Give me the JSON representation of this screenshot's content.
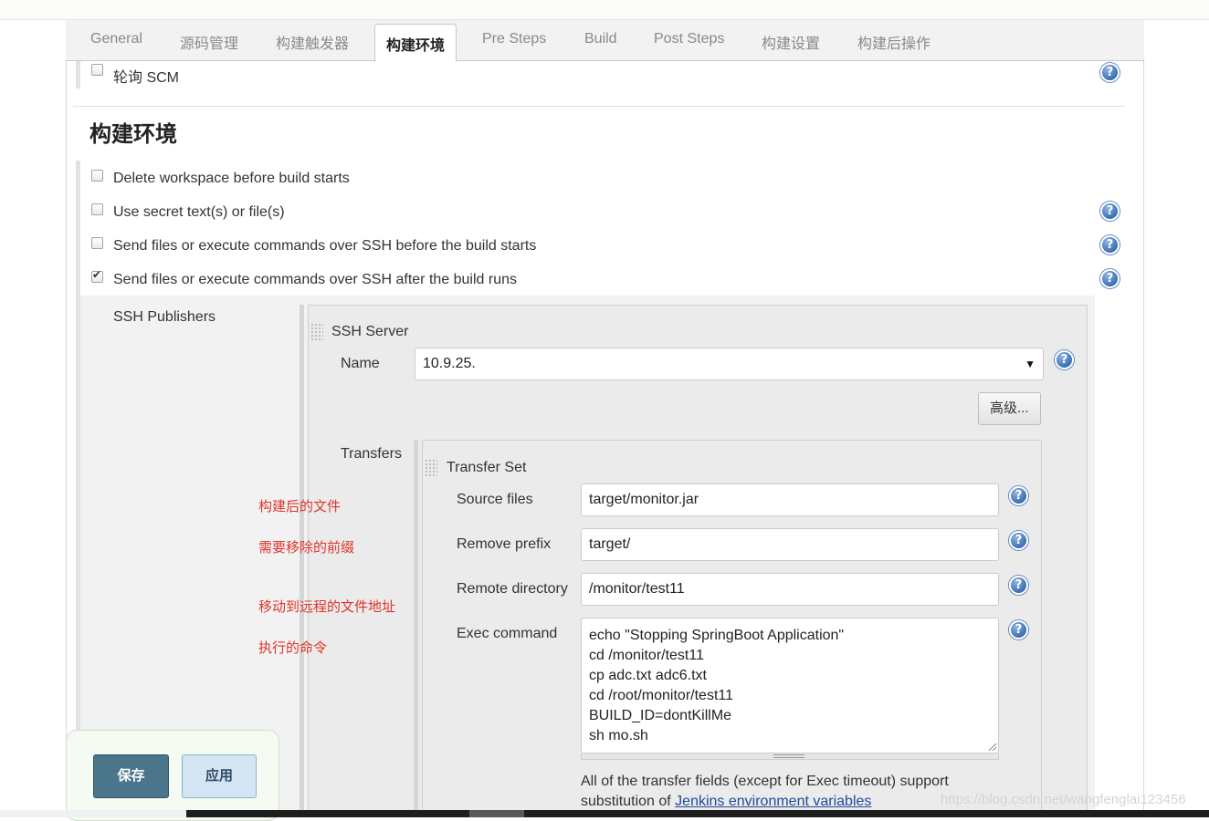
{
  "tabs": [
    "General",
    "源码管理",
    "构建触发器",
    "构建环境",
    "Pre Steps",
    "Build",
    "Post Steps",
    "构建设置",
    "构建后操作"
  ],
  "trigger": {
    "poll_scm": "轮询 SCM"
  },
  "section": {
    "title": "构建环境"
  },
  "options": {
    "delete_workspace": "Delete workspace before build starts",
    "secret_text": "Use secret text(s) or file(s)",
    "ssh_before": "Send files or execute commands over SSH before the build starts",
    "ssh_after": "Send files or execute commands over SSH after the build runs"
  },
  "ssh": {
    "publishers_label": "SSH Publishers",
    "server_title": "SSH Server",
    "name_label": "Name",
    "name_value": "10.9.25.",
    "advanced_button": "高级...",
    "transfers_label": "Transfers",
    "transfer_set_title": "Transfer Set",
    "source_files_label": "Source files",
    "source_files_value": "target/monitor.jar",
    "remove_prefix_label": "Remove prefix",
    "remove_prefix_value": "target/",
    "remote_directory_label": "Remote directory",
    "remote_directory_value": "/monitor/test11",
    "exec_command_label": "Exec command",
    "exec_command_value": "echo \"Stopping SpringBoot Application\"\ncd /monitor/test11\ncp adc.txt adc6.txt\ncd /root/monitor/test11\nBUILD_ID=dontKillMe\nsh mo.sh",
    "note_text": "All of the transfer fields (except for Exec timeout) support substitution of ",
    "note_link": "Jenkins environment variables"
  },
  "annotations": {
    "source": "构建后的文件",
    "prefix": "需要移除的前缀",
    "remote": "移动到远程的文件地址",
    "exec": "执行的命令"
  },
  "buttons": {
    "save": "保存",
    "apply": "应用"
  },
  "help_glyph": "?",
  "watermark": "https://blog.csdn.net/wangfenglai123456",
  "colors": {
    "save_bg": "#4b758b",
    "apply_bg": "#d3e4f2",
    "annotation": "#e0342b",
    "help": "#3b6fb3"
  }
}
